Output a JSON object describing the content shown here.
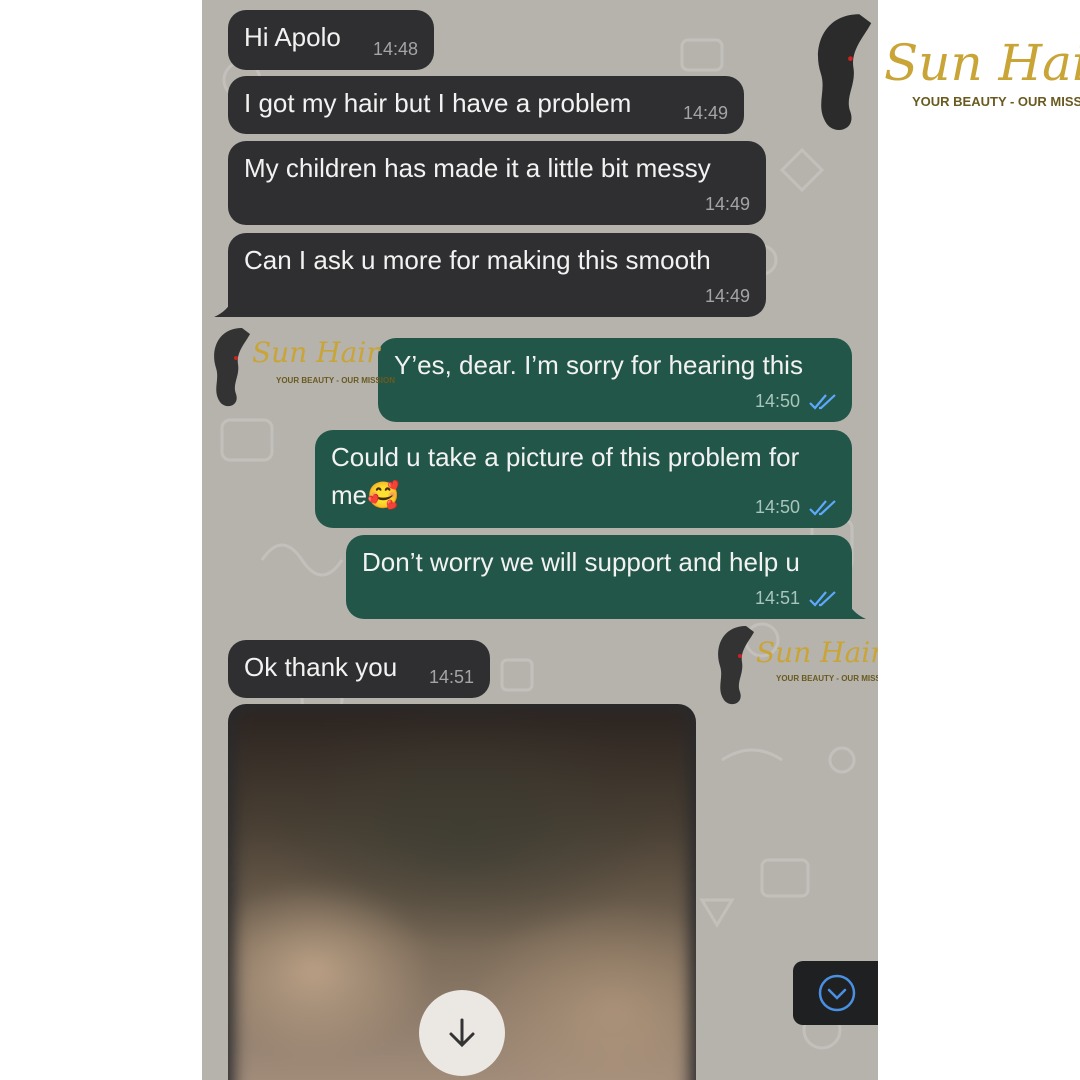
{
  "brand": {
    "name": "Sun Hair",
    "tagline": "YOUR BEAUTY - OUR MISSION"
  },
  "messages": [
    {
      "direction": "in",
      "text": "Hi Apolo",
      "time": "14:48"
    },
    {
      "direction": "in",
      "text": "I got my hair but I have a problem",
      "time": "14:49"
    },
    {
      "direction": "in",
      "text": "My children has made it a little bit messy",
      "time": "14:49"
    },
    {
      "direction": "in",
      "text": "Can I ask u more for making this smooth",
      "time": "14:49"
    },
    {
      "direction": "out",
      "text": "Y’es, dear. I’m sorry for hearing this",
      "time": "14:50",
      "status": "read"
    },
    {
      "direction": "out",
      "text_line1": "Could u take a picture of this problem for",
      "text_line2": "me🥰",
      "time": "14:50",
      "status": "read"
    },
    {
      "direction": "out",
      "text": "Don’t worry we will support and help u",
      "time": "14:51",
      "status": "read"
    },
    {
      "direction": "in",
      "text": "Ok thank you",
      "time": "14:51"
    }
  ],
  "media": {
    "type": "image",
    "state": "blurred-not-downloaded",
    "action_icon": "download-arrow-icon"
  },
  "controls": {
    "scroll_icon": "chevron-down-circle-icon"
  },
  "colors": {
    "chat_background": "#b6b3ad",
    "incoming_bubble": "#2f2f31",
    "outgoing_bubble": "#225648",
    "read_ticks": "#5fa8ff",
    "brand_gold": "#c9a437"
  }
}
